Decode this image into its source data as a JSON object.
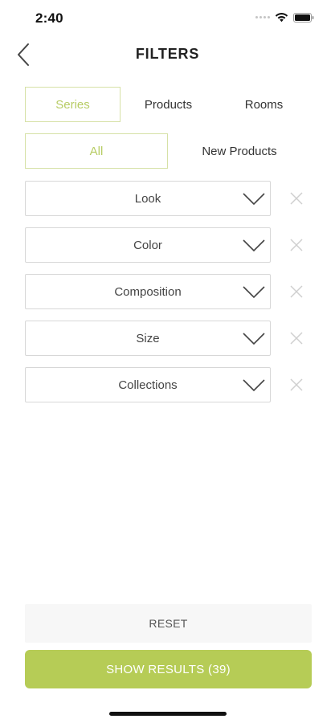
{
  "status_bar": {
    "time": "2:40"
  },
  "header": {
    "title": "FILTERS",
    "back_icon": "chevron-left-icon"
  },
  "tabs": [
    {
      "label": "Series",
      "active": true
    },
    {
      "label": "Products",
      "active": false
    },
    {
      "label": "Rooms",
      "active": false
    }
  ],
  "type_tabs": [
    {
      "label": "All",
      "active": true
    },
    {
      "label": "New Products",
      "active": false
    }
  ],
  "filters": [
    {
      "label": "Look"
    },
    {
      "label": "Color"
    },
    {
      "label": "Composition"
    },
    {
      "label": "Size"
    },
    {
      "label": "Collections"
    }
  ],
  "actions": {
    "reset_label": "RESET",
    "show_results_label": "SHOW RESULTS (39)"
  },
  "colors": {
    "accent": "#b6cc56",
    "accent_text": "#b7cc64",
    "active_border": "#d6e1a6",
    "dropdown_border": "#d7d7d7",
    "reset_bg": "#f7f7f7"
  }
}
